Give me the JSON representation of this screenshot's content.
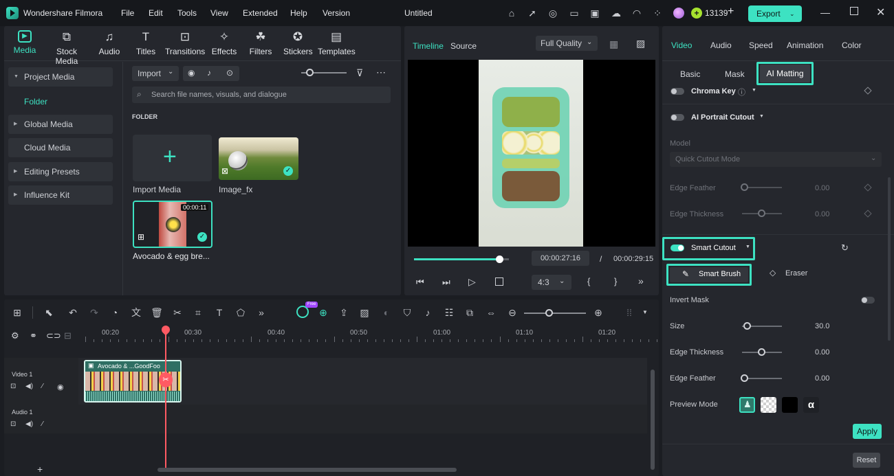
{
  "titlebar": {
    "app_name": "Wondershare Filmora",
    "menu": [
      "File",
      "Edit",
      "Tools",
      "View",
      "Extended",
      "Help",
      "Version"
    ],
    "project_title": "Untitled",
    "credits": "13139",
    "export_label": "Export"
  },
  "toolbar": {
    "tools": [
      {
        "label": "Media",
        "icon": "media-icon"
      },
      {
        "label": "Stock Media",
        "icon": "stock-media-icon"
      },
      {
        "label": "Audio",
        "icon": "audio-icon"
      },
      {
        "label": "Titles",
        "icon": "titles-icon"
      },
      {
        "label": "Transitions",
        "icon": "transitions-icon"
      },
      {
        "label": "Effects",
        "icon": "effects-icon"
      },
      {
        "label": "Filters",
        "icon": "filters-icon"
      },
      {
        "label": "Stickers",
        "icon": "stickers-icon"
      },
      {
        "label": "Templates",
        "icon": "templates-icon"
      }
    ]
  },
  "sidebar": {
    "items": [
      "Project Media",
      "Folder",
      "Global Media",
      "Cloud Media",
      "Editing Presets",
      "Influence Kit"
    ]
  },
  "media": {
    "import_label": "Import",
    "search_placeholder": "Search file names, visuals, and dialogue",
    "folder_heading": "FOLDER",
    "import_media_label": "Import Media",
    "items": [
      {
        "name": "Image_fx"
      },
      {
        "name": "Avocado & egg bre...",
        "duration": "00:00:11"
      }
    ]
  },
  "preview": {
    "tab_timeline": "Timeline",
    "tab_source": "Source",
    "quality": "Full Quality",
    "current_time": "00:00:27:16",
    "separator": "/",
    "total_time": "00:00:29:15",
    "aspect": "4:3",
    "progress": 0.9
  },
  "timeline": {
    "ruler": [
      "00:20",
      "00:30",
      "00:40",
      "00:50",
      "01:00",
      "01:10",
      "01:20"
    ],
    "video_track": "Video 1",
    "audio_track": "Audio 1",
    "clip_label": "Avocado & ...GoodFoo",
    "free_badge": "Free"
  },
  "right_panel": {
    "tabs": [
      "Video",
      "Audio",
      "Speed",
      "Animation",
      "Color"
    ],
    "subtabs": [
      "Basic",
      "Mask",
      "AI Matting"
    ],
    "chroma_key": "Chroma Key",
    "ai_portrait": "AI Portrait Cutout",
    "model_label": "Model",
    "model_value": "Quick Cutout Mode",
    "edge_feather_label": "Edge Feather",
    "edge_feather_value": "0.00",
    "edge_thickness_label": "Edge Thickness",
    "edge_thickness_value": "0.00",
    "smart_cutout": "Smart Cutout",
    "smart_brush": "Smart Brush",
    "eraser": "Eraser",
    "invert_mask": "Invert Mask",
    "size_label": "Size",
    "size_value": "30.0",
    "edge_thickness2_label": "Edge Thickness",
    "edge_thickness2_value": "0.00",
    "edge_feather2_label": "Edge Feather",
    "edge_feather2_value": "0.00",
    "preview_mode_label": "Preview Mode",
    "alpha_glyph": "α",
    "apply_label": "Apply",
    "reset_label": "Reset",
    "accent": "#3de2c2"
  }
}
